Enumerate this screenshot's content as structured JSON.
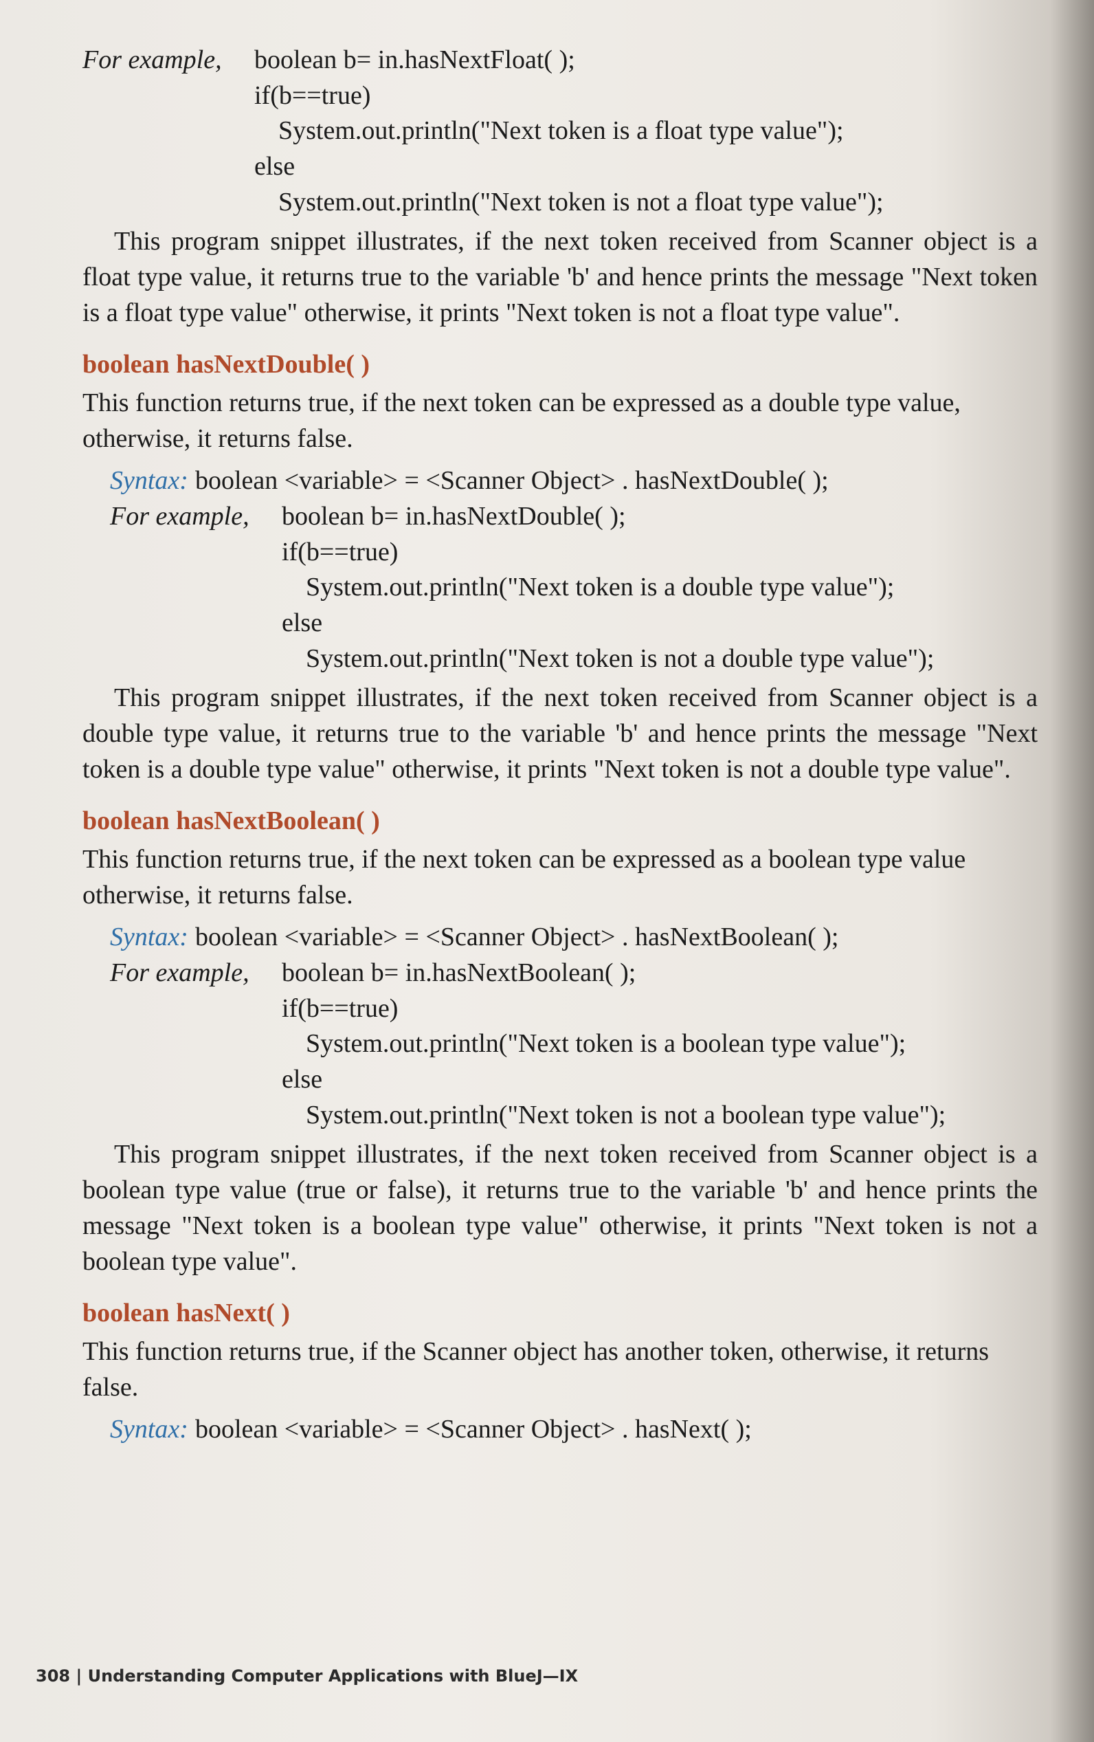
{
  "example_label": "For example,",
  "syntax_label": "Syntax:",
  "top_example": {
    "line1": "boolean b= in.hasNextFloat( );",
    "line2": "if(b==true)",
    "line3": "System.out.println(\"Next token is a float type value\");",
    "line4": "else",
    "line5": "System.out.println(\"Next token is not a float type value\");",
    "paragraph": "This program snippet illustrates, if the next token received from Scanner object is a float type value, it returns true to the variable 'b' and hence prints the message \"Next token is a float type value\" otherwise, it prints \"Next token is not a float type value\"."
  },
  "double_section": {
    "heading": "boolean hasNextDouble( )",
    "description": "This function returns true, if the next token can be expressed as a double type value, otherwise, it returns false.",
    "syntax": "boolean <variable> = <Scanner Object> . hasNextDouble( );",
    "line1": "boolean b= in.hasNextDouble( );",
    "line2": "if(b==true)",
    "line3": "System.out.println(\"Next token is a double type value\");",
    "line4": "else",
    "line5": "System.out.println(\"Next token is not a double type value\");",
    "paragraph": "This program snippet illustrates, if the next token received from Scanner object is a double type value, it returns true to the variable 'b' and hence prints the message \"Next token is a double type value\" otherwise, it prints \"Next token is not a double type value\"."
  },
  "boolean_section": {
    "heading": "boolean hasNextBoolean( )",
    "description": "This function returns true, if the next token can be expressed as a boolean type value otherwise, it returns false.",
    "syntax": "boolean <variable> = <Scanner Object> . hasNextBoolean( );",
    "line1": "boolean b= in.hasNextBoolean( );",
    "line2": "if(b==true)",
    "line3": "System.out.println(\"Next token is a boolean type value\");",
    "line4": "else",
    "line5": "System.out.println(\"Next token is not a boolean type value\");",
    "paragraph": "This program snippet illustrates, if the next token received from Scanner object is a boolean type value (true or false), it returns true to the variable 'b' and hence prints the message \"Next token is a boolean type value\" otherwise, it prints \"Next token is not a boolean type value\"."
  },
  "hasnext_section": {
    "heading": "boolean hasNext( )",
    "description": "This function returns true, if the Scanner object has another token, otherwise, it returns false.",
    "syntax": "boolean <variable> = <Scanner Object> . hasNext( );"
  },
  "footer": "308 | Understanding Computer Applications with BlueJ—IX",
  "colors": {
    "heading": "#b04a2a",
    "syntax_label": "#2f6fa8"
  }
}
